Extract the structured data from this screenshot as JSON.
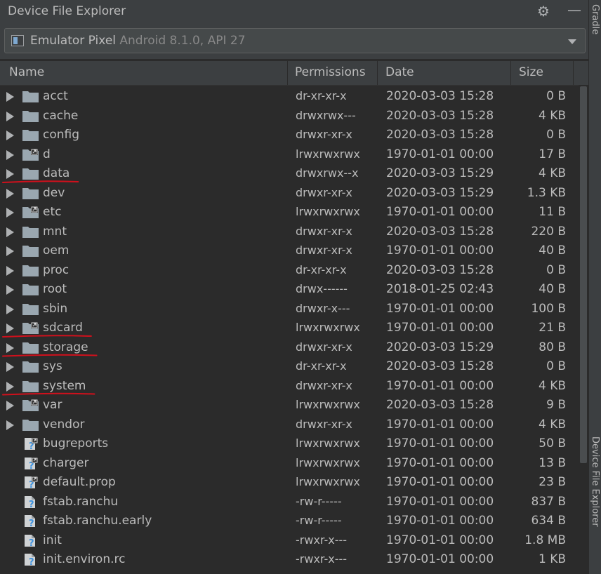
{
  "window": {
    "title": "Device File Explorer",
    "side_label_top": "Gradle",
    "side_label_bottom": "Device File Explorer",
    "icons": [
      "gear-icon",
      "minimize-icon"
    ]
  },
  "device": {
    "name": "Emulator Pixel",
    "detail": "Android 8.1.0, API 27",
    "icon": "emulator-icon"
  },
  "columns": {
    "name": "Name",
    "permissions": "Permissions",
    "date": "Date",
    "size": "Size"
  },
  "files": [
    {
      "name": "acct",
      "permissions": "dr-xr-xr-x",
      "date": "2020-03-03 15:28",
      "size": "0 B",
      "kind": "folder",
      "expandable": true
    },
    {
      "name": "cache",
      "permissions": "drwxrwx---",
      "date": "2020-03-03 15:28",
      "size": "4 KB",
      "kind": "folder",
      "expandable": true
    },
    {
      "name": "config",
      "permissions": "drwxr-xr-x",
      "date": "2020-03-03 15:28",
      "size": "0 B",
      "kind": "folder",
      "expandable": true
    },
    {
      "name": "d",
      "permissions": "lrwxrwxrwx",
      "date": "1970-01-01 00:00",
      "size": "17 B",
      "kind": "folder-link",
      "expandable": true
    },
    {
      "name": "data",
      "permissions": "drwxrwx--x",
      "date": "2020-03-03 15:29",
      "size": "4 KB",
      "kind": "folder",
      "expandable": true
    },
    {
      "name": "dev",
      "permissions": "drwxr-xr-x",
      "date": "2020-03-03 15:29",
      "size": "1.3 KB",
      "kind": "folder",
      "expandable": true
    },
    {
      "name": "etc",
      "permissions": "lrwxrwxrwx",
      "date": "1970-01-01 00:00",
      "size": "11 B",
      "kind": "folder-link",
      "expandable": true
    },
    {
      "name": "mnt",
      "permissions": "drwxr-xr-x",
      "date": "2020-03-03 15:28",
      "size": "220 B",
      "kind": "folder",
      "expandable": true
    },
    {
      "name": "oem",
      "permissions": "drwxr-xr-x",
      "date": "1970-01-01 00:00",
      "size": "40 B",
      "kind": "folder",
      "expandable": true
    },
    {
      "name": "proc",
      "permissions": "dr-xr-xr-x",
      "date": "2020-03-03 15:28",
      "size": "0 B",
      "kind": "folder",
      "expandable": true
    },
    {
      "name": "root",
      "permissions": "drwx------",
      "date": "2018-01-25 02:43",
      "size": "40 B",
      "kind": "folder",
      "expandable": true
    },
    {
      "name": "sbin",
      "permissions": "drwxr-x---",
      "date": "1970-01-01 00:00",
      "size": "100 B",
      "kind": "folder",
      "expandable": true
    },
    {
      "name": "sdcard",
      "permissions": "lrwxrwxrwx",
      "date": "1970-01-01 00:00",
      "size": "21 B",
      "kind": "folder-link",
      "expandable": true
    },
    {
      "name": "storage",
      "permissions": "drwxr-xr-x",
      "date": "2020-03-03 15:29",
      "size": "80 B",
      "kind": "folder",
      "expandable": true
    },
    {
      "name": "sys",
      "permissions": "dr-xr-xr-x",
      "date": "2020-03-03 15:28",
      "size": "0 B",
      "kind": "folder",
      "expandable": true
    },
    {
      "name": "system",
      "permissions": "drwxr-xr-x",
      "date": "1970-01-01 00:00",
      "size": "4 KB",
      "kind": "folder",
      "expandable": true
    },
    {
      "name": "var",
      "permissions": "lrwxrwxrwx",
      "date": "2020-03-03 15:28",
      "size": "9 B",
      "kind": "folder-link",
      "expandable": true
    },
    {
      "name": "vendor",
      "permissions": "drwxr-xr-x",
      "date": "1970-01-01 00:00",
      "size": "4 KB",
      "kind": "folder",
      "expandable": true
    },
    {
      "name": "bugreports",
      "permissions": "lrwxrwxrwx",
      "date": "1970-01-01 00:00",
      "size": "50 B",
      "kind": "file-link",
      "expandable": false
    },
    {
      "name": "charger",
      "permissions": "lrwxrwxrwx",
      "date": "1970-01-01 00:00",
      "size": "13 B",
      "kind": "file-link",
      "expandable": false
    },
    {
      "name": "default.prop",
      "permissions": "lrwxrwxrwx",
      "date": "1970-01-01 00:00",
      "size": "23 B",
      "kind": "file-link",
      "expandable": false
    },
    {
      "name": "fstab.ranchu",
      "permissions": "-rw-r-----",
      "date": "1970-01-01 00:00",
      "size": "837 B",
      "kind": "file",
      "expandable": false
    },
    {
      "name": "fstab.ranchu.early",
      "permissions": "-rw-r-----",
      "date": "1970-01-01 00:00",
      "size": "634 B",
      "kind": "file",
      "expandable": false
    },
    {
      "name": "init",
      "permissions": "-rwxr-x---",
      "date": "1970-01-01 00:00",
      "size": "1.8 MB",
      "kind": "file",
      "expandable": false
    },
    {
      "name": "init.environ.rc",
      "permissions": "-rwxr-x---",
      "date": "1970-01-01 00:00",
      "size": "1 KB",
      "kind": "file",
      "expandable": false
    }
  ],
  "annotations": {
    "color": "#d0101c",
    "underlined_items": [
      "data",
      "sdcard",
      "storage",
      "system"
    ]
  },
  "colors": {
    "background": "#2b2b2b",
    "toolbar": "#3c3f41",
    "text": "#bbbbbb",
    "folder": "#9aa7b0",
    "unknown_file_mark": "#3c92e0"
  }
}
